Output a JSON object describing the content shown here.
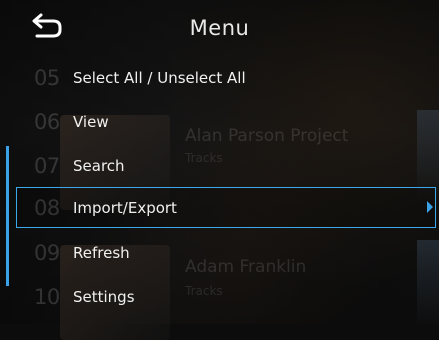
{
  "header": {
    "title": "Menu",
    "back_icon": "back-arrow-icon"
  },
  "background": {
    "ghost_lines": [
      "Alan Parson Project",
      "Tracks",
      "Adam Franklin",
      "Tracks"
    ]
  },
  "menu": {
    "items": [
      {
        "number": "05",
        "label": "Select All / Unselect All",
        "has_submenu": false,
        "selected": false
      },
      {
        "number": "06",
        "label": "View",
        "has_submenu": false,
        "selected": false
      },
      {
        "number": "07",
        "label": "Search",
        "has_submenu": false,
        "selected": false
      },
      {
        "number": "08",
        "label": "Import/Export",
        "has_submenu": true,
        "selected": true
      },
      {
        "number": "09",
        "label": "Refresh",
        "has_submenu": false,
        "selected": false
      },
      {
        "number": "10",
        "label": "Settings",
        "has_submenu": false,
        "selected": false
      }
    ]
  },
  "colors": {
    "accent": "#3aa2e6",
    "text": "#f0f0f0",
    "number_dim": "rgba(255,255,255,0.16)"
  }
}
